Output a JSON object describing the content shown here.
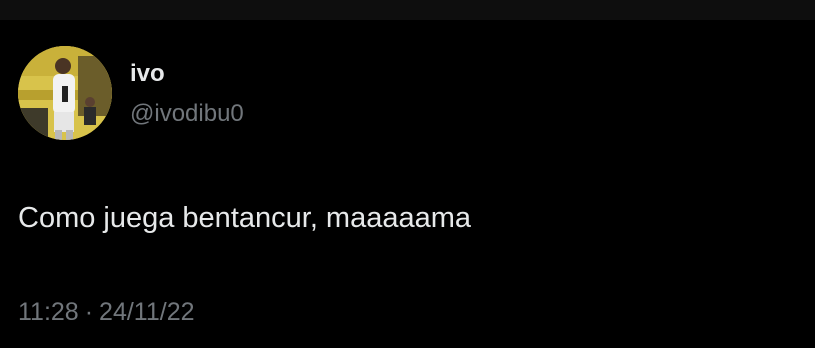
{
  "tweet": {
    "author": {
      "display_name": "ivo",
      "handle": "@ivodibu0",
      "avatar": "avatar-photo"
    },
    "text": "Como juega bentancur, maaaaama",
    "time": "11:28",
    "separator": "·",
    "date": "24/11/22"
  },
  "colors": {
    "background": "#000000",
    "primary_text": "#e7e9ea",
    "secondary_text": "#71767b"
  }
}
